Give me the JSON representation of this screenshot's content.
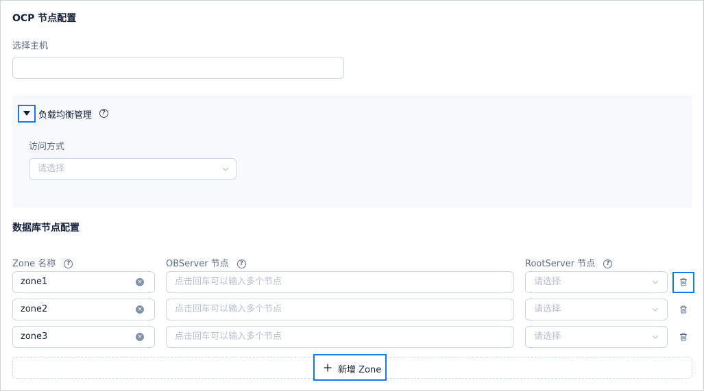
{
  "ocp": {
    "title": "OCP 节点配置",
    "host_label": "选择主机",
    "host_value": ""
  },
  "lb": {
    "title": "负载均衡管理",
    "access_label": "访问方式",
    "access_placeholder": "请选择"
  },
  "db": {
    "title": "数据库节点配置",
    "columns": {
      "zone": "Zone 名称",
      "observer": "OBServer 节点",
      "rootserver": "RootServer 节点"
    },
    "rows": [
      {
        "zone": "zone1",
        "observer_placeholder": "点击回车可以输入多个节点",
        "rootserver_placeholder": "请选择"
      },
      {
        "zone": "zone2",
        "observer_placeholder": "点击回车可以输入多个节点",
        "rootserver_placeholder": "请选择"
      },
      {
        "zone": "zone3",
        "observer_placeholder": "点击回车可以输入多个节点",
        "rootserver_placeholder": "请选择"
      }
    ],
    "add_zone_label": "新增 Zone"
  },
  "icons": {
    "help": "question-circle-icon",
    "collapse": "caret-down-icon",
    "clear": "close-circle-icon",
    "select": "chevron-down-icon",
    "delete": "trash-icon",
    "add": "plus-icon"
  },
  "colors": {
    "accent": "#1677e6",
    "panel_bg": "#f7f9fc",
    "border": "#cdd5e4",
    "placeholder": "#b6bfd0"
  }
}
